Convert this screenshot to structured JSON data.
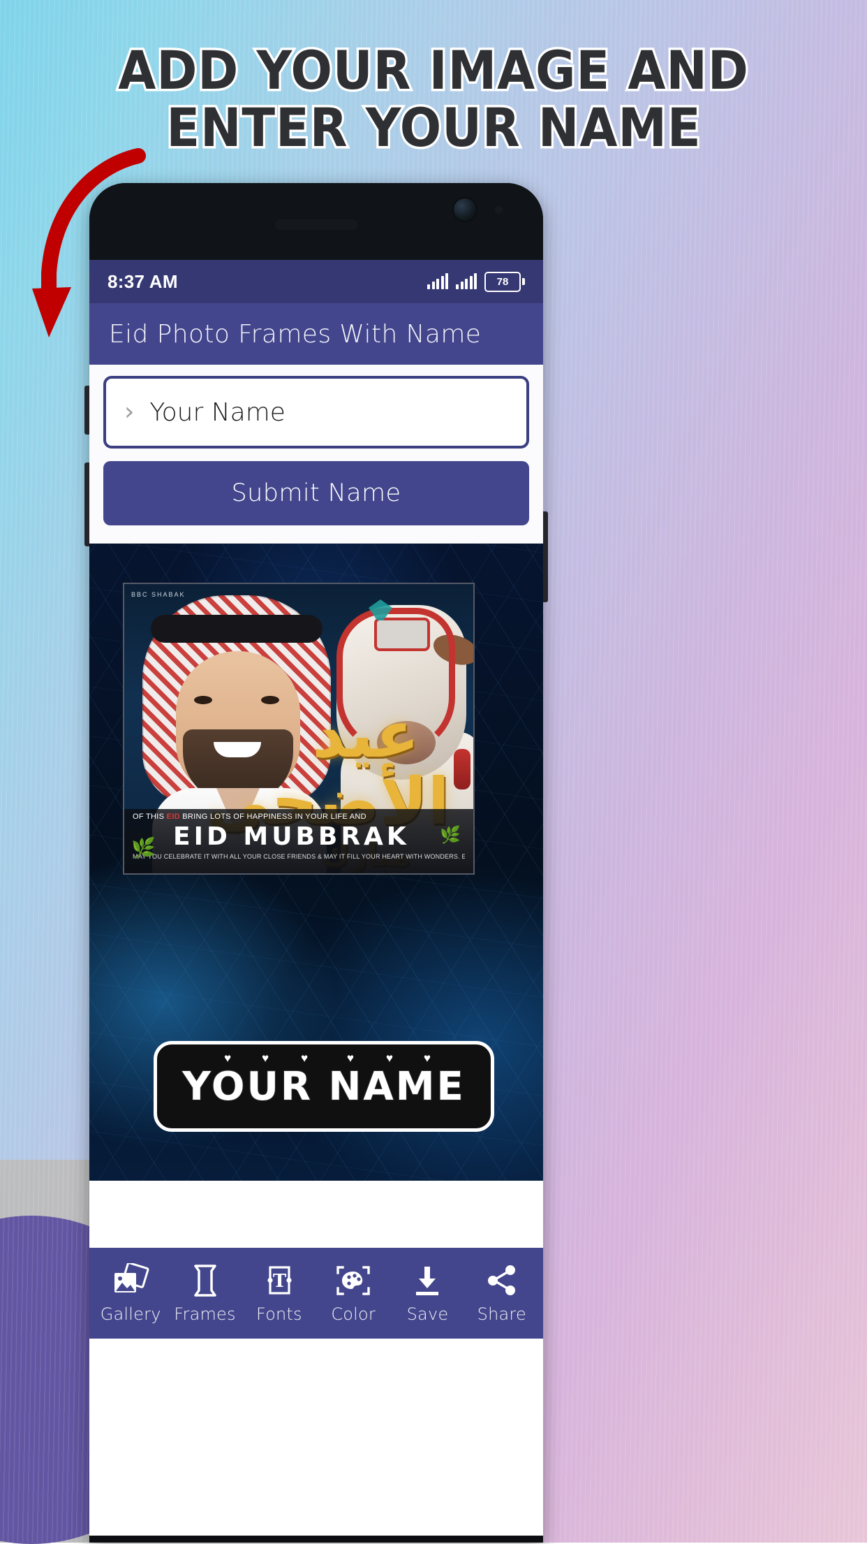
{
  "promo": {
    "headline_line1": "ADD YOUR IMAGE AND",
    "headline_line2": "ENTER YOUR NAME",
    "arrow_icon": "curved-arrow-icon"
  },
  "statusbar": {
    "time": "8:37 AM",
    "signal_icon_1": "signal-bars-icon",
    "signal_icon_2": "signal-bars-icon",
    "battery_level": "78",
    "battery_icon": "battery-icon"
  },
  "appbar": {
    "title": "Eid Photo Frames With Name"
  },
  "form": {
    "chevron_icon": "chevron-right-icon",
    "name_placeholder": "Your Name",
    "name_value": "",
    "submit_label": "Submit Name"
  },
  "canvas": {
    "frame_logo": "BBC SHABAK",
    "frame_banner_top_prefix": "OF THIS ",
    "frame_banner_top_highlight": "EID",
    "frame_banner_top_suffix": " BRING LOTS OF HAPPINESS IN YOUR LIFE AND",
    "frame_banner_main": "EID  MUBBRAK",
    "frame_banner_sub": "MAY YOU CELEBRATE IT WITH ALL YOUR CLOSE FRIENDS & MAY IT FILL YOUR HEART WITH WONDERS. EID MUBARAK.",
    "arabic_main": "عيد الأضحى",
    "arabic_sub": "مبارك",
    "wheat_icon_left": "wheat-icon",
    "wheat_icon_right": "wheat-icon",
    "nameplate_text": "YOUR NAME",
    "heart_icon": "heart-icon"
  },
  "bottomnav": {
    "items": [
      {
        "label": "Gallery",
        "icon": "gallery-icon"
      },
      {
        "label": "Frames",
        "icon": "frame-icon"
      },
      {
        "label": "Fonts",
        "icon": "text-t-icon"
      },
      {
        "label": "Color",
        "icon": "palette-icon"
      },
      {
        "label": "Save",
        "icon": "download-icon"
      },
      {
        "label": "Share",
        "icon": "share-nodes-icon"
      }
    ]
  },
  "colors": {
    "primary": "#43468c",
    "statusbar": "#363873",
    "accent_gold": "#e8b53a",
    "arrow_red": "#c00000"
  }
}
